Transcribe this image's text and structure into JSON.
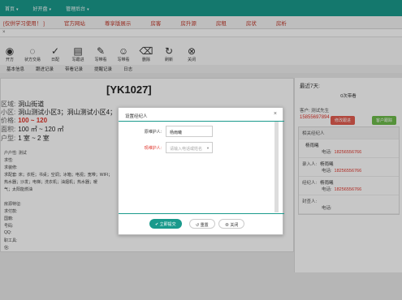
{
  "nav": {
    "items": [
      "首页",
      "好开盘",
      "管理后台"
    ]
  },
  "tabs": [
    "[仅供学习使用！ ]",
    "官方网站",
    "尊享版展示",
    "房客",
    "房升源",
    "房租",
    "房状",
    "房析"
  ],
  "toolbar": [
    {
      "icon": "eye-icon",
      "glyph": "◉",
      "label": "开方"
    },
    {
      "icon": "status-icon",
      "glyph": "◌",
      "label": "状方交易"
    },
    {
      "icon": "check-icon",
      "glyph": "✓",
      "label": "日配"
    },
    {
      "icon": "doc-icon",
      "glyph": "▤",
      "label": "写跟进"
    },
    {
      "icon": "chat-icon",
      "glyph": "✎",
      "label": "写带看"
    },
    {
      "icon": "comment-icon",
      "glyph": "☺",
      "label": "写带看"
    },
    {
      "icon": "trash-icon",
      "glyph": "⌫",
      "label": "删除"
    },
    {
      "icon": "refresh-icon",
      "glyph": "↻",
      "label": "刷新"
    },
    {
      "icon": "close-icon",
      "glyph": "⊗",
      "label": "关闭"
    }
  ],
  "subtabs": [
    "基本信息",
    "跟进记录",
    "带看记录",
    "提醒记录",
    "日志"
  ],
  "house": {
    "code": "[YK1027]",
    "area_label": "区域:",
    "area_value": "洞山街道",
    "community_label": "小区:",
    "community_value": "洞山测试小区3；洞山测试小区4；",
    "price_label": "价格:",
    "price_value": "100 ~ 120",
    "size_label": "面积:",
    "size_value": "100 ㎡ ~ 120 ㎡",
    "layout_label": "户型:",
    "layout_value": "1 室 ~ 2 室",
    "detail_rows": [
      "户户性:   测试",
      "求性:",
      "求装修:",
      "求配套:   床；衣柜；书桌；空调；冰箱；电视；宽带；WIFI；",
      "          热水器；沙发；电梯；洗衣机；油烟机；热水器；暖",
      "          气；太阳能燃油",
      "",
      "房源特征:",
      "求付款:",
      "国籍:",
      "号码:",
      "QQ:",
      "职工具:",
      "信:"
    ]
  },
  "side": {
    "title": "最近7天:",
    "subtitle": "0次带看",
    "owner_label": "客户:",
    "owner_value": "测试先生",
    "owner_phone": "15855697894",
    "btn_red": "修改跟进",
    "btn_green": "客户跟踪",
    "related_title": "相关经纪人",
    "rows": [
      {
        "k": "",
        "name": "杨雨曦",
        "tel_label": "电话:",
        "tel": "18256556766"
      },
      {
        "k": "录入人:",
        "name": "杨雨曦",
        "tel_label": "电话:",
        "tel": "18256556766"
      },
      {
        "k": "经纪人:",
        "name": "杨雨曦",
        "tel_label": "电话:",
        "tel": "18256556766"
      },
      {
        "k": "封查人:",
        "name": "",
        "tel_label": "电话:",
        "tel": ""
      }
    ]
  },
  "dialog": {
    "title": "设置经纪人",
    "original_label": "原维护人:",
    "original_value": "杨雨曦",
    "new_label": "现维护人:",
    "new_placeholder": "请输入电话或姓名",
    "submit": "立即提交",
    "reset": "重置",
    "close": "关闭"
  }
}
